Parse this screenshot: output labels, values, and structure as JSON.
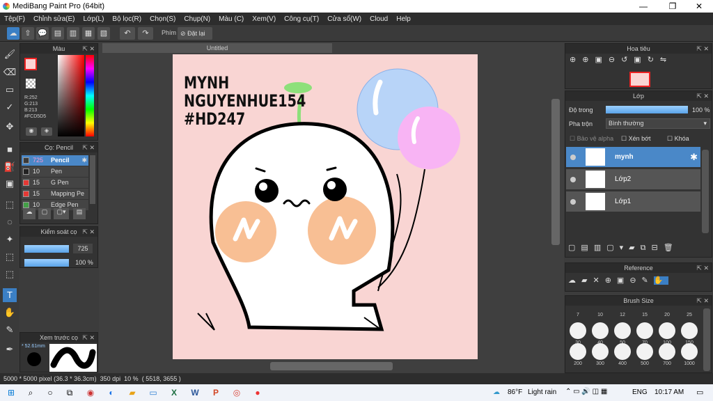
{
  "window": {
    "title": "MediBang Paint Pro (64bit)",
    "minimize": "—",
    "maximize": "❐",
    "close": "✕"
  },
  "menu": [
    "Tệp(F)",
    "Chỉnh sửa(E)",
    "Lớp(L)",
    "Bộ lọc(R)",
    "Chọn(S)",
    "Chụp(N)",
    "Màu (C)",
    "Xem(V)",
    "Công cụ(T)",
    "Cửa sổ(W)",
    "Cloud",
    "Help"
  ],
  "toolbar": {
    "phim_label": "Phím",
    "reset_label": "Đặt lại"
  },
  "color_panel": {
    "title": "Màu",
    "r": "R:252",
    "g": "G:213",
    "b": "B:213",
    "hex": "#FCD5D5",
    "main_color": "#fcd5d5"
  },
  "brush_panel": {
    "title": "Cọ: Pencil",
    "items": [
      {
        "size": "725",
        "name": "Pencil",
        "color": "#3a3a3a"
      },
      {
        "size": "10",
        "name": "Pen",
        "color": "#222222"
      },
      {
        "size": "15",
        "name": "G Pen",
        "color": "#e53935"
      },
      {
        "size": "15",
        "name": "Mapping Pe",
        "color": "#e53935"
      },
      {
        "size": "10",
        "name": "Edge Pen",
        "color": "#43a047"
      }
    ]
  },
  "brush_control": {
    "title": "Kiểm soát cọ",
    "size": "725",
    "opacity": "100 %",
    "size_fraction": 1.0,
    "opacity_fraction": 1.0
  },
  "brush_preview": {
    "title": "Xem trước cọ",
    "size": "* 52.61mm"
  },
  "canvas": {
    "tab": "Untitled"
  },
  "artwork": {
    "line1": "MYNH",
    "line2": "NGUYENHUE154",
    "line3": "#HD247"
  },
  "navigator": {
    "title": "Hoa tiêu"
  },
  "layer_panel": {
    "title": "Lớp",
    "opacity_label": "Độ trong",
    "opacity_value": "100 %",
    "opacity_fraction": 1.0,
    "blend_label": "Pha trộn",
    "blend_value": "Bình thường",
    "protect_alpha": "Bảo vệ alpha",
    "clipping": "Xén bớt",
    "lock": "Khóa",
    "layers": [
      {
        "name": "mynh",
        "selected": true
      },
      {
        "name": "Lớp2",
        "selected": false
      },
      {
        "name": "Lớp1",
        "selected": false
      }
    ]
  },
  "reference": {
    "title": "Reference"
  },
  "brush_size": {
    "title": "Brush Size",
    "row1": [
      "7",
      "10",
      "12",
      "15",
      "20",
      "25"
    ],
    "row2": [
      "30",
      "40",
      "50",
      "70",
      "100",
      "150"
    ],
    "row3": [
      "200",
      "300",
      "400",
      "500",
      "700",
      "1000"
    ]
  },
  "status": {
    "dims": "5000 * 5000 pixel",
    "physical": "(36.3 * 36.3cm)",
    "dpi": "350 dpi",
    "zoom": "10 %",
    "coords": "( 5518, 3655 )"
  },
  "taskbar": {
    "weather_temp": "86°F",
    "weather_text": "Light rain",
    "lang": "ENG",
    "time": "10:17 AM"
  }
}
